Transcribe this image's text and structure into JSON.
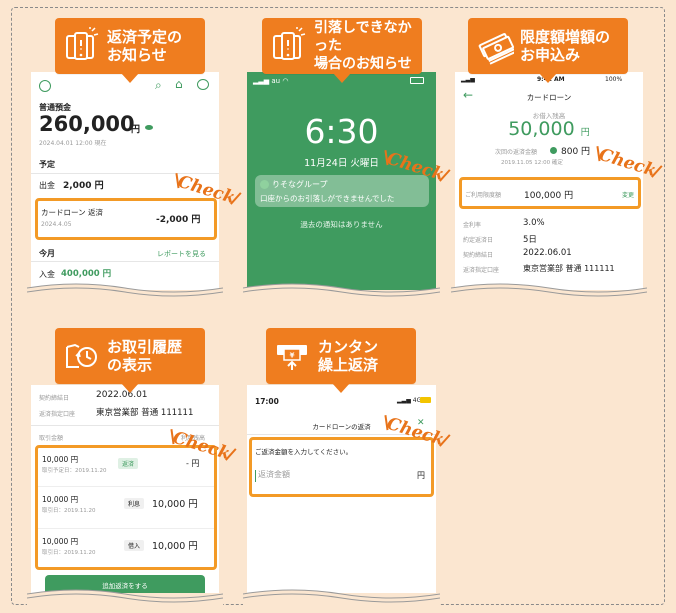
{
  "check_label": "Check",
  "cards": {
    "repayment_notice": {
      "title": "返済予定の\nお知らせ",
      "icon": "phone-notification-icon",
      "screen": {
        "account_type": "普通預金",
        "balance": "260,000",
        "currency": "円",
        "as_of": "2024.04.01 12:00 現在",
        "section_planned": "予定",
        "withdrawal_label": "出金",
        "withdrawal_amount": "2,000 円",
        "loan_title": "カードローン 返済",
        "loan_date": "2024.4.05",
        "loan_amount": "-2,000 円",
        "section_this_month": "今月",
        "report_link": "レポートを見る",
        "deposit_label": "入金",
        "deposit_amount": "400,000 円"
      }
    },
    "debit_failure": {
      "title": "引落しできなかった\n場合のお知らせ",
      "icon": "phone-notification-icon",
      "screen": {
        "carrier": "au",
        "time": "6:30",
        "date": "11月24日 火曜日",
        "app_name": "りそなグループ",
        "message": "口座からのお引落しができませんでした",
        "no_past": "過去の通知はありません"
      }
    },
    "limit_increase": {
      "title": "限度額増額の\nお申込み",
      "icon": "money-stack-icon",
      "screen": {
        "status_time": "9:41 AM",
        "status_battery": "100%",
        "nav_title": "カードローン",
        "borrow_balance_label": "お借入残高",
        "borrow_balance": "50,000",
        "currency": "円",
        "next_payment_label": "次回の返済金額",
        "next_payment": "800 円",
        "next_payment_date": "2019.11.05 12:00 確定",
        "limit_label": "ご利用限度額",
        "limit_value": "100,000 円",
        "change_link": "変更",
        "rows": [
          {
            "label": "金利率",
            "value": "3.0%"
          },
          {
            "label": "約定返済日",
            "value": "5日"
          },
          {
            "label": "契約締結日",
            "value": "2022.06.01"
          },
          {
            "label": "返済指定口座",
            "value": "東京営業部 普通 111111"
          }
        ]
      }
    },
    "transaction_history": {
      "title": "お取引履歴\nの表示",
      "icon": "history-icon",
      "screen": {
        "contract_date_label": "契約締結日",
        "contract_date": "2022.06.01",
        "account_label": "返済指定口座",
        "account_value": "東京営業部 普通 111111",
        "table_header_left": "取引金額",
        "table_header_right": "利用残高",
        "rows": [
          {
            "amount": "10,000 円",
            "sub": "取引予定日：2019.11.20",
            "tag": "返済",
            "balance": "- 円"
          },
          {
            "amount": "10,000 円",
            "sub": "取引日：2019.11.20",
            "tag": "利息",
            "balance": "10,000 円"
          },
          {
            "amount": "10,000 円",
            "sub": "取引日：2019.11.20",
            "tag": "借入",
            "balance": "10,000 円"
          }
        ],
        "button": "追加返済をする"
      }
    },
    "easy_prepay": {
      "title": "カンタン\n繰上返済",
      "icon": "atm-icon",
      "screen": {
        "status_time": "17:00",
        "status_signal": "4G",
        "nav_title": "カードローンの返済",
        "close": "✕",
        "prompt": "ご返済金額を入力してください。",
        "input_placeholder": "返済金額",
        "unit": "円"
      }
    }
  }
}
